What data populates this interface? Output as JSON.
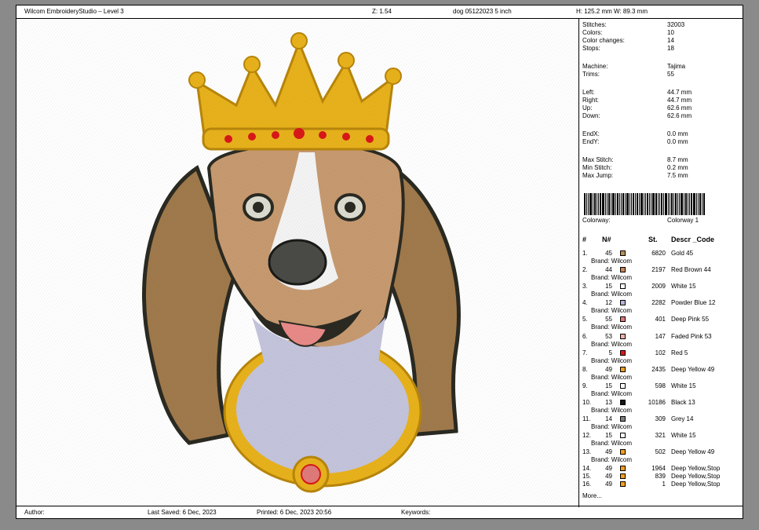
{
  "header": {
    "title": "Wilcom EmbroideryStudio – Level 3",
    "zoom": "Z: 1.54",
    "design_name": "dog 05122023 5 inch",
    "size": "H: 125.2 mm   W: 89.3 mm"
  },
  "stats": {
    "stitches_label": "Stitches:",
    "stitches": "32003",
    "colors_label": "Colors:",
    "colors": "10",
    "color_changes_label": "Color changes:",
    "color_changes": "14",
    "stops_label": "Stops:",
    "stops": "18",
    "machine_label": "Machine:",
    "machine": "Tajima",
    "trims_label": "Trims:",
    "trims": "55",
    "left_label": "Left:",
    "left": "44.7 mm",
    "right_label": "Right:",
    "right": "44.7 mm",
    "up_label": "Up:",
    "up": "62.6 mm",
    "down_label": "Down:",
    "down": "62.6 mm",
    "endx_label": "EndX:",
    "endx": "0.0 mm",
    "endy_label": "EndY:",
    "endy": "0.0 mm",
    "max_stitch_label": "Max Stitch:",
    "max_stitch": "8.7 mm",
    "min_stitch_label": "Min Stitch:",
    "min_stitch": "0.2 mm",
    "max_jump_label": "Max Jump:",
    "max_jump": "7.5 mm",
    "colorway_label": "Colorway:",
    "colorway": "Colorway 1"
  },
  "table": {
    "headers": {
      "idx": "#",
      "n": "N#",
      "st": "St.",
      "desc": "Descr _Code"
    },
    "rows": [
      {
        "idx": "1.",
        "n": "45",
        "color": "#b8905a",
        "st": "6820",
        "desc": "Gold 45",
        "brand": "Brand: Wilcom"
      },
      {
        "idx": "2.",
        "n": "44",
        "color": "#c9885a",
        "st": "2197",
        "desc": "Red Brown 44",
        "brand": "Brand: Wilcom"
      },
      {
        "idx": "3.",
        "n": "15",
        "color": "#ffffff",
        "st": "2009",
        "desc": "White 15",
        "brand": "Brand: Wilcom"
      },
      {
        "idx": "4.",
        "n": "12",
        "color": "#b4b4d8",
        "st": "2282",
        "desc": "Powder Blue 12",
        "brand": "Brand: Wilcom"
      },
      {
        "idx": "5.",
        "n": "55",
        "color": "#e07a7a",
        "st": "401",
        "desc": "Deep Pink 55",
        "brand": "Brand: Wilcom"
      },
      {
        "idx": "6.",
        "n": "53",
        "color": "#f0b0a8",
        "st": "147",
        "desc": "Faded Pink 53",
        "brand": "Brand: Wilcom"
      },
      {
        "idx": "7.",
        "n": "5",
        "color": "#d81818",
        "st": "102",
        "desc": "Red 5",
        "brand": "Brand: Wilcom"
      },
      {
        "idx": "8.",
        "n": "49",
        "color": "#f0a020",
        "st": "2435",
        "desc": "Deep Yellow 49",
        "brand": "Brand: Wilcom"
      },
      {
        "idx": "9.",
        "n": "15",
        "color": "#ffffff",
        "st": "598",
        "desc": "White 15",
        "brand": "Brand: Wilcom"
      },
      {
        "idx": "10.",
        "n": "13",
        "color": "#151515",
        "st": "10186",
        "desc": "Black 13",
        "brand": "Brand: Wilcom"
      },
      {
        "idx": "11.",
        "n": "14",
        "color": "#808080",
        "st": "309",
        "desc": "Grey 14",
        "brand": "Brand: Wilcom"
      },
      {
        "idx": "12.",
        "n": "15",
        "color": "#ffffff",
        "st": "321",
        "desc": "White 15",
        "brand": "Brand: Wilcom"
      },
      {
        "idx": "13.",
        "n": "49",
        "color": "#f0a020",
        "st": "502",
        "desc": "Deep Yellow 49",
        "brand": "Brand: Wilcom"
      }
    ],
    "stops": [
      {
        "idx": "14.",
        "n": "49",
        "color": "#f0a020",
        "st": "1964",
        "desc": "Deep Yellow,Stop"
      },
      {
        "idx": "15.",
        "n": "49",
        "color": "#f0a020",
        "st": "839",
        "desc": "Deep Yellow,Stop"
      },
      {
        "idx": "16.",
        "n": "49",
        "color": "#f0a020",
        "st": "1",
        "desc": "Deep Yellow,Stop"
      }
    ],
    "more": "More..."
  },
  "footer": {
    "author": "Author:",
    "last_saved": "Last Saved:  6 Dec, 2023",
    "printed": "Printed:  6 Dec, 2023 20:56",
    "keywords": "Keywords:"
  },
  "colors": {
    "gold": "#e8b21c",
    "gold_dark": "#b8860b",
    "fur_light": "#c79a70",
    "fur_dark": "#7a5a30",
    "outline": "#2a2a22",
    "chest": "#c4c4dc",
    "white": "#f4f4f4",
    "tongue": "#e88a88",
    "jewel": "#d81818"
  }
}
